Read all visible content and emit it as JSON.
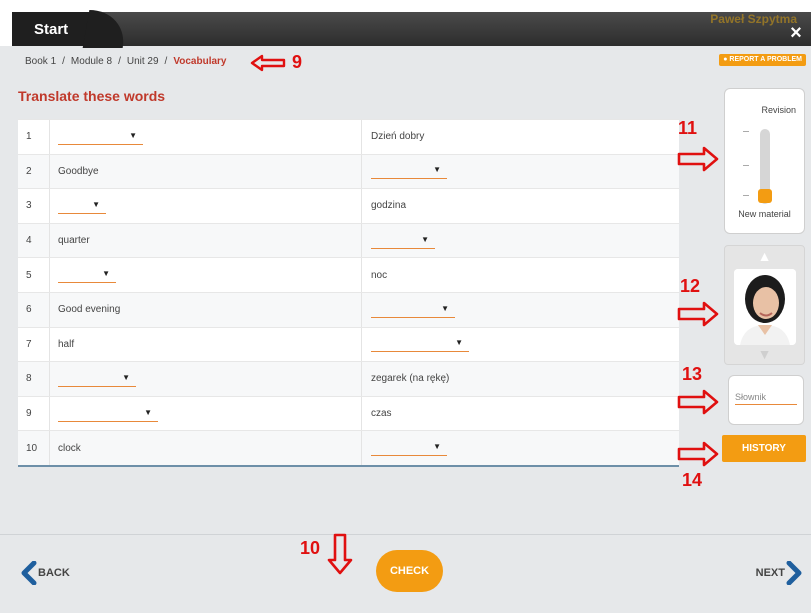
{
  "header": {
    "start_label": "Start",
    "user_name": "Paweł Szpytma",
    "close_glyph": "×"
  },
  "breadcrumb": {
    "items": [
      "Book 1",
      "Module 8",
      "Unit 29"
    ],
    "current": "Vocabulary",
    "separator": "/"
  },
  "report_problem_label": "REPORT A PROBLEM",
  "page_title": "Translate these words",
  "exercise_rows": [
    {
      "num": "1",
      "left": "",
      "right": "Dzień dobry"
    },
    {
      "num": "2",
      "left": "Goodbye",
      "right": ""
    },
    {
      "num": "3",
      "left": "",
      "right": "godzina"
    },
    {
      "num": "4",
      "left": "quarter",
      "right": ""
    },
    {
      "num": "5",
      "left": "",
      "right": "noc"
    },
    {
      "num": "6",
      "left": "Good evening",
      "right": ""
    },
    {
      "num": "7",
      "left": "half",
      "right": ""
    },
    {
      "num": "8",
      "left": "",
      "right": "zegarek (na rękę)"
    },
    {
      "num": "9",
      "left": "",
      "right": "czas"
    },
    {
      "num": "10",
      "left": "clock",
      "right": ""
    }
  ],
  "revision": {
    "top_label": "Revision",
    "bottom_label": "New material"
  },
  "dictionary": {
    "placeholder": "Słownik"
  },
  "history_label": "HISTORY",
  "footer": {
    "back_label": "BACK",
    "check_label": "CHECK",
    "next_label": "NEXT"
  },
  "annotations": [
    "9",
    "10",
    "11",
    "12",
    "13",
    "14"
  ],
  "colors": {
    "accent": "#f39c12",
    "title_red": "#c0392b",
    "annotation_red": "#e01010"
  }
}
